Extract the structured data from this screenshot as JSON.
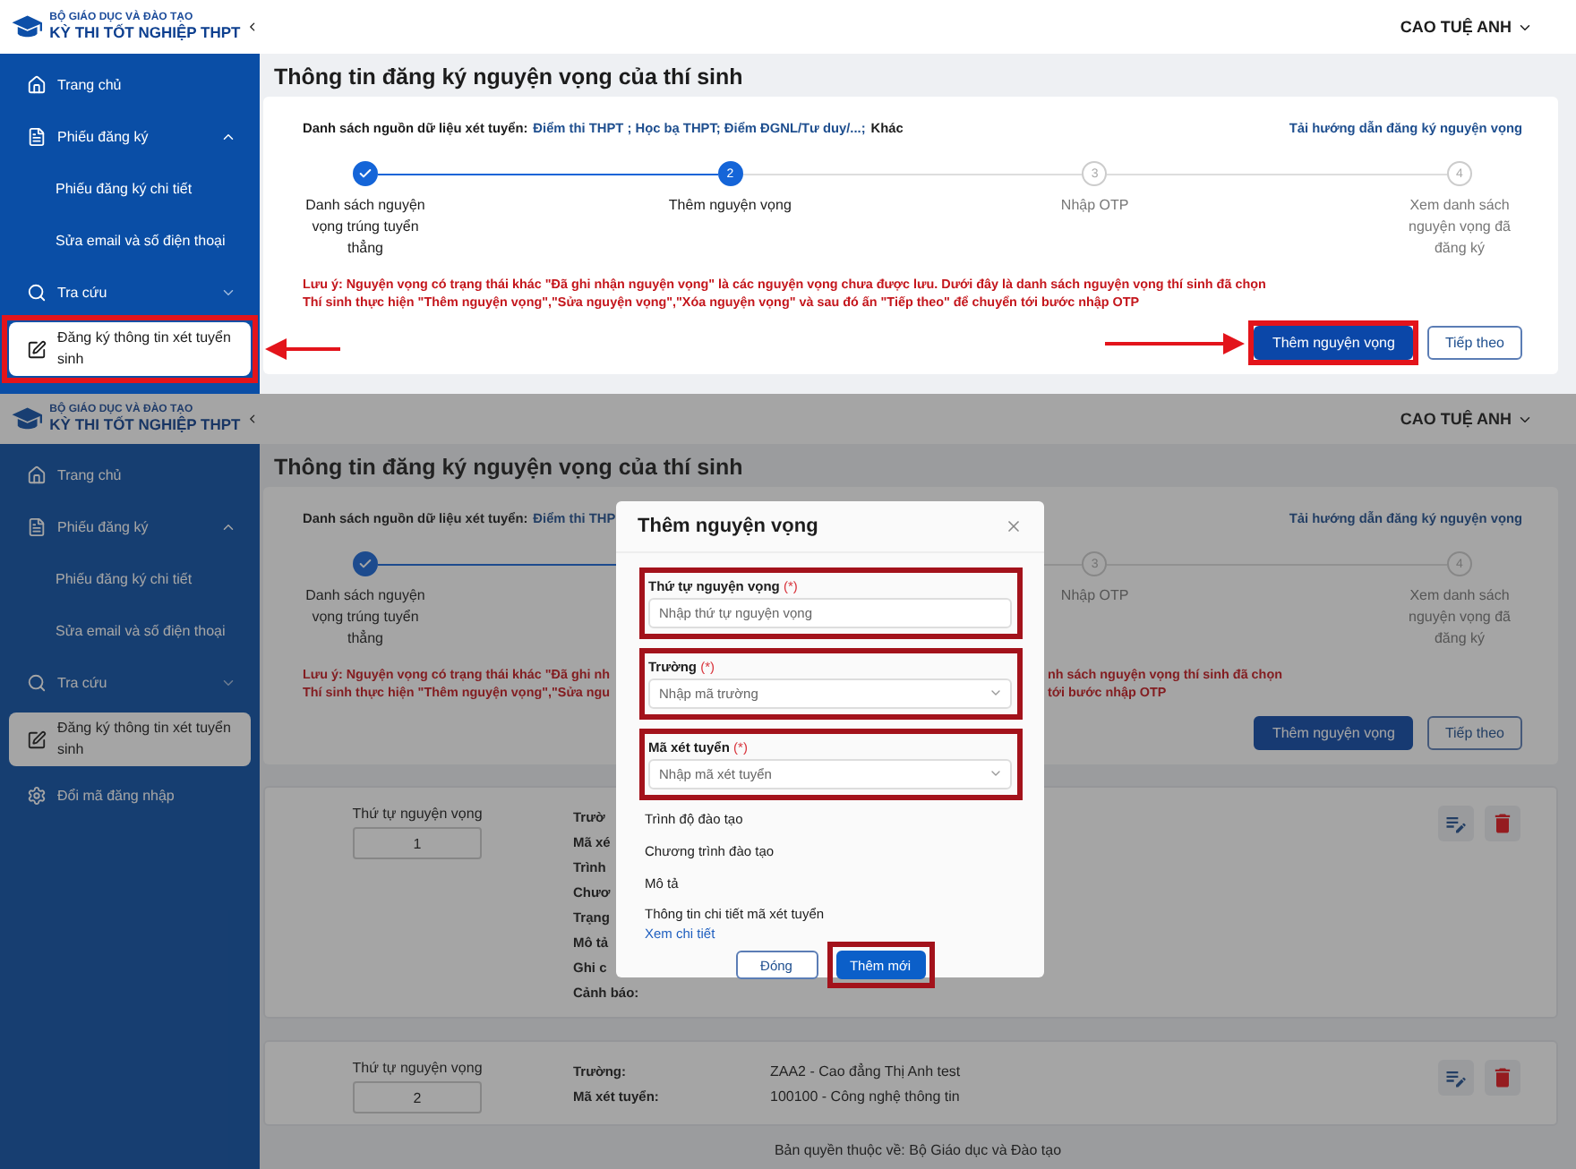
{
  "screens": [
    {
      "header": {
        "org": "BỘ GIÁO DỤC VÀ ĐÀO TẠO",
        "system": "KỲ THI TỐT NGHIỆP THPT",
        "user": "CAO TUỆ ANH"
      },
      "sidebar": [
        {
          "kind": "item",
          "label": "Trang chủ",
          "selected": false
        },
        {
          "kind": "group",
          "label": "Phiếu đăng ký",
          "expanded": true,
          "selected": false
        },
        {
          "kind": "subitem",
          "label": "Phiếu đăng ký chi tiết",
          "selected": false
        },
        {
          "kind": "subitem",
          "label": "Sửa email và số điện thoại",
          "selected": false
        },
        {
          "kind": "group",
          "label": "Tra cứu",
          "expanded": false,
          "selected": false
        },
        {
          "kind": "item",
          "label": "Đăng ký thông tin xét tuyển sinh",
          "selected": true,
          "highlighted": true,
          "pointer_arrow": true
        }
      ],
      "page_title": "Thông tin đăng ký nguyện vọng của thí sinh",
      "card": {
        "sources_label": "Danh sách nguồn dữ liệu xét tuyển:",
        "sources_parts": [
          {
            "text": "Điểm thi THPT ; Học bạ THPT; Điểm ĐGNL/Tư duy/...;",
            "link": true
          },
          {
            "text": "Khác",
            "link": false
          }
        ],
        "guide_link": "Tải hướng dẫn đăng ký nguyện vọng",
        "steps": [
          {
            "completed": true,
            "current": false,
            "label": "Danh sách nguyện vọng trúng tuyển thẳng"
          },
          {
            "completed": false,
            "current": true,
            "number": "2",
            "label": "Thêm nguyện vọng"
          },
          {
            "completed": false,
            "current": false,
            "number": "3",
            "label": "Nhập OTP"
          },
          {
            "completed": false,
            "current": false,
            "number": "4",
            "label": "Xem danh sách nguyện vọng đã đăng ký"
          }
        ],
        "notice": [
          [
            "Lưu ý: Nguyện vọng có trạng thái khác \"Đã ghi nhận nguyện vọng\" là các nguyện vọng chưa được lưu. Dưới đây là danh sách nguyện vọng thí sinh đã chọn"
          ],
          [
            "Thí sinh thực hiện \"Thêm nguyện vọng\",\"Sửa nguyện vọng\",\"Xóa nguyện vọng\" và sau đó ấn \"Tiếp theo\" để chuyển tới bước nhập OTP"
          ]
        ],
        "buttons": [
          {
            "label": "Thêm nguyện vọng",
            "kind": "primary",
            "highlighted": true,
            "pointer_arrow": true
          },
          {
            "label": "Tiếp theo",
            "kind": "secondary",
            "highlighted": false
          }
        ]
      }
    },
    {
      "header": {
        "org": "BỘ GIÁO DỤC VÀ ĐÀO TẠO",
        "system": "KỲ THI TỐT NGHIỆP THPT",
        "user": "CAO TUỆ ANH"
      },
      "sidebar": [
        {
          "kind": "item",
          "label": "Trang chủ",
          "selected": false
        },
        {
          "kind": "group",
          "label": "Phiếu đăng ký",
          "expanded": true,
          "selected": false
        },
        {
          "kind": "subitem",
          "label": "Phiếu đăng ký chi tiết",
          "selected": false
        },
        {
          "kind": "subitem",
          "label": "Sửa email và số điện thoại",
          "selected": false
        },
        {
          "kind": "group",
          "label": "Tra cứu",
          "expanded": false,
          "selected": false
        },
        {
          "kind": "item",
          "label": "Đăng ký thông tin xét tuyển sinh",
          "selected": true
        },
        {
          "kind": "item",
          "label": "Đổi mã đăng nhập",
          "selected": false
        }
      ],
      "page_title": "Thông tin đăng ký nguyện vọng của thí sinh",
      "card": {
        "sources_label": "Danh sách nguồn dữ liệu xét tuyển:",
        "sources_parts": [
          {
            "text": "Điểm thi THP",
            "link": true
          }
        ],
        "guide_link": "Tải hướng dẫn đăng ký nguyện vọng",
        "steps": [
          {
            "completed": true,
            "current": false,
            "label": "Danh sách nguyện vọng trúng tuyển thẳng"
          },
          {
            "completed": false,
            "current": false,
            "number": "3",
            "label": "Nhập OTP"
          },
          {
            "completed": false,
            "current": false,
            "number": "4",
            "label": "Xem danh sách nguyện vọng đã đăng ký"
          }
        ],
        "notice": [
          [
            "Lưu ý: Nguyện vọng có trạng thái khác \"Đã ghi nh",
            "nh sách nguyện vọng thí sinh đã chọn"
          ],
          [
            "Thí sinh thực hiện \"Thêm nguyện vọng\",\"Sửa ngu",
            "tới bước nhập OTP"
          ]
        ],
        "buttons": [
          {
            "label": "Thêm nguyện vọng",
            "kind": "primary",
            "highlighted": false
          },
          {
            "label": "Tiếp theo",
            "kind": "secondary",
            "highlighted": false
          }
        ]
      },
      "wishes": [
        {
          "order_label": "Thứ tự nguyện vọng",
          "order": "1",
          "fields": [
            {
              "label": "Trườ"
            },
            {
              "label": "Mã xé"
            },
            {
              "label": "Trình"
            },
            {
              "label": "Chươ"
            },
            {
              "label": "Trạng"
            },
            {
              "label": "Mô tả"
            },
            {
              "label": "Ghi c"
            },
            {
              "label": "Cảnh báo:"
            }
          ]
        },
        {
          "order_label": "Thứ tự nguyện vọng",
          "order": "2",
          "fields": [
            {
              "label": "Trường:",
              "value": "ZAA2 - Cao đẳng Thị Anh test"
            },
            {
              "label": "Mã xét tuyển:",
              "value": "100100 - Công nghệ thông tin"
            }
          ]
        }
      ],
      "footer": "Bản quyền thuộc về: Bộ Giáo dục và Đào tạo",
      "modal": {
        "title": "Thêm nguyện vọng",
        "fields": [
          {
            "label": "Thứ tự nguyện vọng",
            "required_mark": "(*)",
            "placeholder": "Nhập thứ tự nguyện vọng",
            "kind": "text",
            "highlighted": true
          },
          {
            "label": "Trường",
            "required_mark": "(*)",
            "placeholder": "Nhập mã trường",
            "kind": "select",
            "highlighted": true
          },
          {
            "label": "Mã xét tuyển",
            "required_mark": "(*)",
            "placeholder": "Nhập mã xét tuyển",
            "kind": "select",
            "highlighted": true
          }
        ],
        "info": [
          "Trình độ đào tạo",
          "Chương trình đào tạo",
          "Mô tả",
          "Thông tin chi tiết mã xét tuyển"
        ],
        "detail_link": "Xem chi tiết",
        "buttons": [
          {
            "label": "Đóng",
            "kind": "secondary",
            "highlighted": false
          },
          {
            "label": "Thêm mới",
            "kind": "primary",
            "highlighted": true
          }
        ]
      }
    }
  ]
}
